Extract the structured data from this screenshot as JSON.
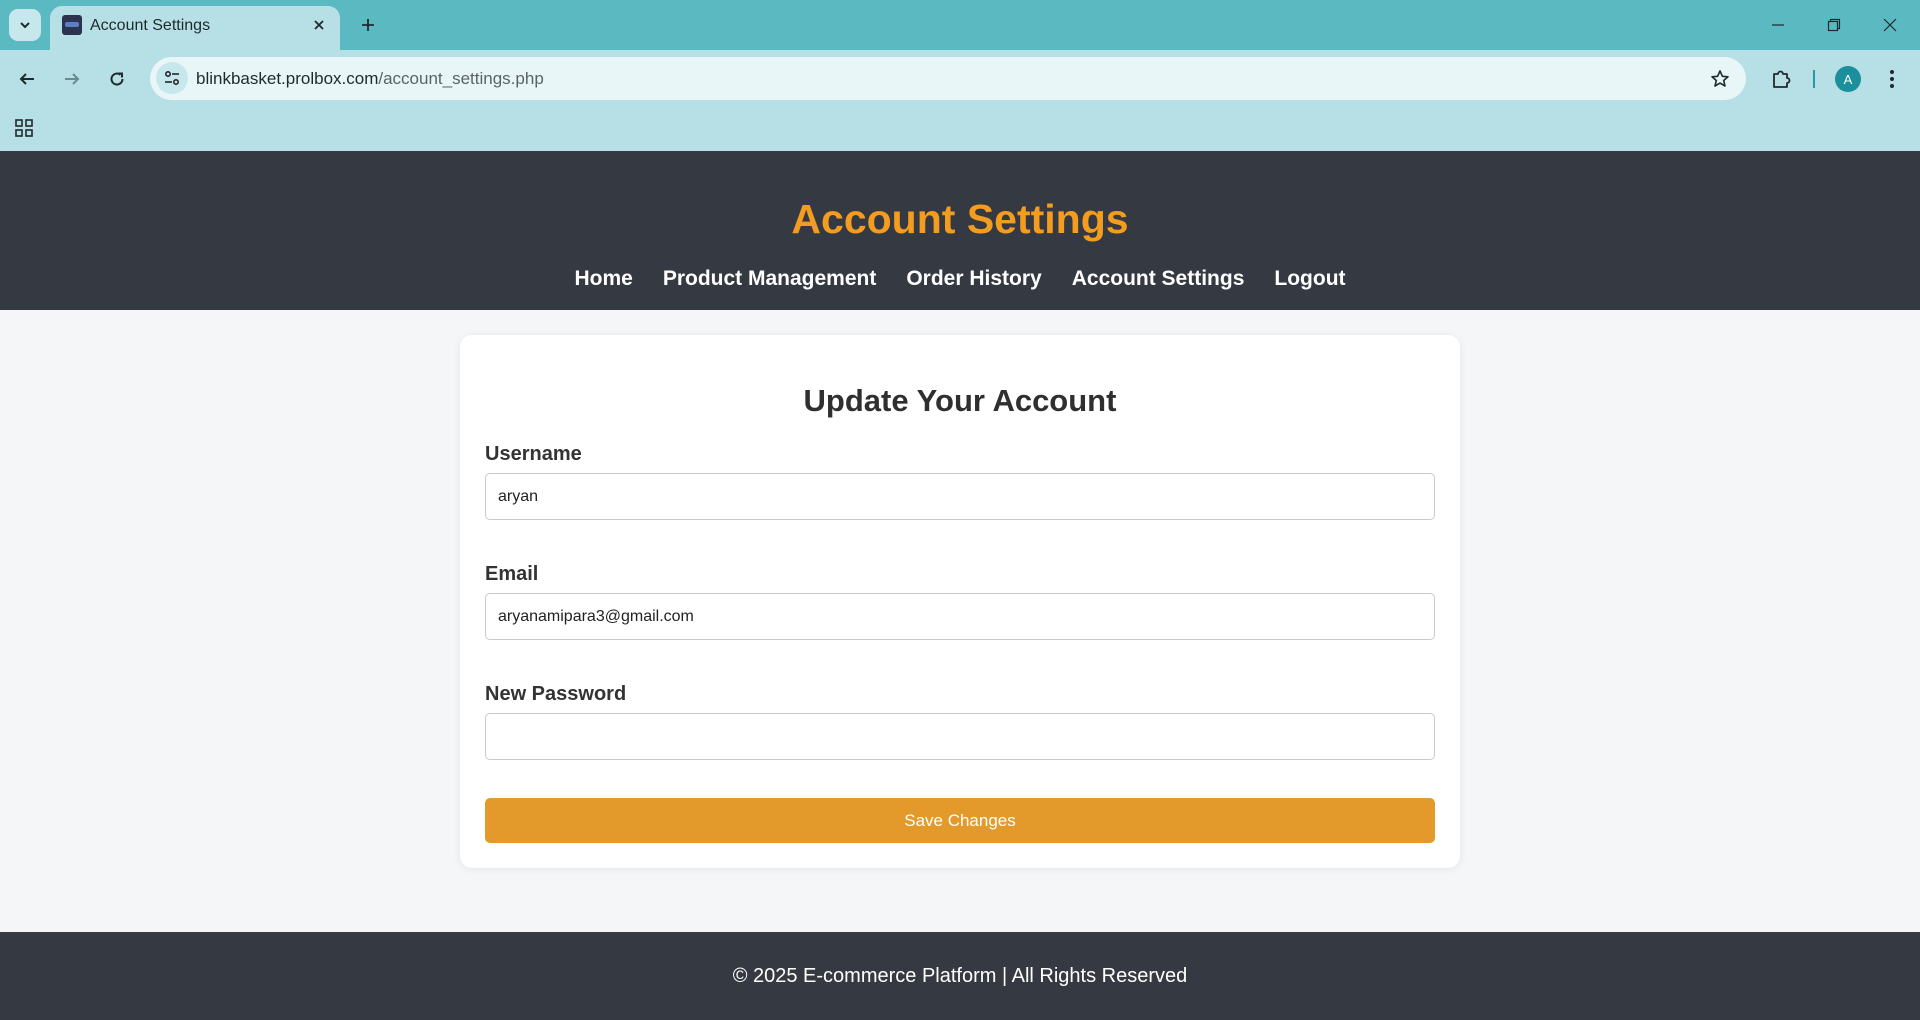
{
  "browser": {
    "tab_title": "Account Settings",
    "url_domain": "blinkbasket.prolbox.com",
    "url_path": "/account_settings.php",
    "profile_initial": "A"
  },
  "header": {
    "title": "Account Settings",
    "title_color": "#f39c1f",
    "nav": [
      {
        "label": "Home"
      },
      {
        "label": "Product Management"
      },
      {
        "label": "Order History"
      },
      {
        "label": "Account Settings"
      },
      {
        "label": "Logout"
      }
    ]
  },
  "form": {
    "title": "Update Your Account",
    "username": {
      "label": "Username",
      "value": "aryan"
    },
    "email": {
      "label": "Email",
      "value": "aryanamipara3@gmail.com"
    },
    "password": {
      "label": "New Password",
      "value": ""
    },
    "submit_label": "Save Changes",
    "submit_color": "#e39a2a"
  },
  "footer": {
    "text": "© 2025 E-commerce Platform | All Rights Reserved"
  }
}
